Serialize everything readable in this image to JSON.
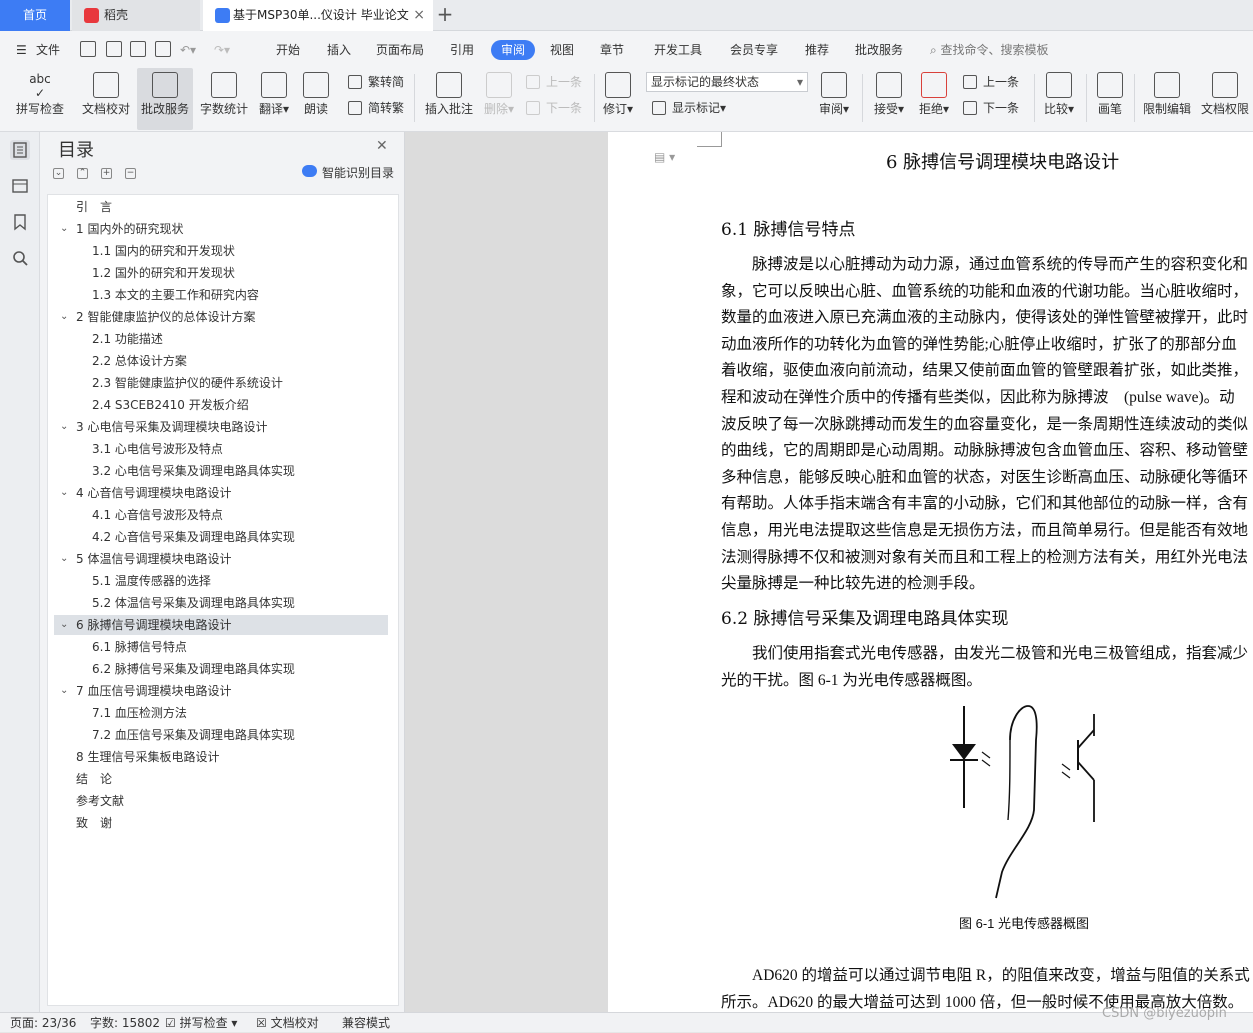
{
  "tabs": {
    "home": "首页",
    "daoke": "稻壳",
    "doc": "基于MSP30单...仪设计 毕业论文",
    "close": "×",
    "add": "+"
  },
  "menu": {
    "file": "文件",
    "items": [
      "开始",
      "插入",
      "页面布局",
      "引用",
      "审阅",
      "视图",
      "章节",
      "开发工具",
      "会员专享",
      "推荐",
      "批改服务"
    ],
    "active": "审阅",
    "search": "查找命令、搜索模板"
  },
  "ribbon": {
    "spellcheck": "拼写检查",
    "doccheck": "文档校对",
    "correct": "批改服务",
    "wordcount": "字数统计",
    "translate": "翻译",
    "read": "朗读",
    "trad": "繁转简",
    "simp": "简转繁",
    "insert_comment": "插入批注",
    "delete": "删除",
    "prev_comment": "上一条",
    "next_comment": "下一条",
    "revise": "修订",
    "markup_select": "显示标记的最终状态",
    "show_markup": "显示标记",
    "review": "审阅",
    "accept": "接受",
    "reject": "拒绝",
    "prev": "上一条",
    "next": "下一条",
    "compare": "比较",
    "pen": "画笔",
    "restrict": "限制编辑",
    "permission": "文档权限"
  },
  "toc": {
    "title": "目录",
    "smart": "智能识别目录",
    "items": [
      {
        "label": "引　言",
        "level": 0,
        "arrow": ""
      },
      {
        "label": "1  国内外的研究现状",
        "level": 0,
        "arrow": "v"
      },
      {
        "label": "1.1 国内的研究和开发现状",
        "level": 1,
        "arrow": ""
      },
      {
        "label": "1.2 国外的研究和开发现状",
        "level": 1,
        "arrow": ""
      },
      {
        "label": "1.3 本文的主要工作和研究内容",
        "level": 1,
        "arrow": ""
      },
      {
        "label": "2 智能健康监护仪的总体设计方案",
        "level": 0,
        "arrow": "v"
      },
      {
        "label": "2.1 功能描述",
        "level": 1,
        "arrow": ""
      },
      {
        "label": "2.2 总体设计方案",
        "level": 1,
        "arrow": ""
      },
      {
        "label": "2.3 智能健康监护仪的硬件系统设计",
        "level": 1,
        "arrow": ""
      },
      {
        "label": "2.4 S3CEB2410 开发板介绍",
        "level": 1,
        "arrow": ""
      },
      {
        "label": "3 心电信号采集及调理模块电路设计",
        "level": 0,
        "arrow": "v"
      },
      {
        "label": "3.1 心电信号波形及特点",
        "level": 1,
        "arrow": ""
      },
      {
        "label": "3.2 心电信号采集及调理电路具体实现",
        "level": 1,
        "arrow": ""
      },
      {
        "label": "4 心音信号调理模块电路设计",
        "level": 0,
        "arrow": "v"
      },
      {
        "label": "4.1 心音信号波形及特点",
        "level": 1,
        "arrow": ""
      },
      {
        "label": "4.2 心音信号采集及调理电路具体实现",
        "level": 1,
        "arrow": ""
      },
      {
        "label": "5 体温信号调理模块电路设计",
        "level": 0,
        "arrow": "v"
      },
      {
        "label": "5.1 温度传感器的选择",
        "level": 1,
        "arrow": ""
      },
      {
        "label": "5.2 体温信号采集及调理电路具体实现",
        "level": 1,
        "arrow": ""
      },
      {
        "label": "6 脉搏信号调理模块电路设计",
        "level": 0,
        "arrow": "v",
        "selected": true
      },
      {
        "label": "6.1 脉搏信号特点",
        "level": 1,
        "arrow": ""
      },
      {
        "label": "6.2 脉搏信号采集及调理电路具体实现",
        "level": 1,
        "arrow": ""
      },
      {
        "label": "7 血压信号调理模块电路设计",
        "level": 0,
        "arrow": "v"
      },
      {
        "label": "7.1 血压检测方法",
        "level": 1,
        "arrow": ""
      },
      {
        "label": "7.2 血压信号采集及调理电路具体实现",
        "level": 1,
        "arrow": ""
      },
      {
        "label": "8 生理信号采集板电路设计",
        "level": 0,
        "arrow": ""
      },
      {
        "label": "结　论",
        "level": 0,
        "arrow": ""
      },
      {
        "label": "参考文献",
        "level": 0,
        "arrow": ""
      },
      {
        "label": "致　谢",
        "level": 0,
        "arrow": ""
      }
    ]
  },
  "doc": {
    "h1": "6 脉搏信号调理模块电路设计",
    "h2a": "6.1 脉搏信号特点",
    "para1": [
      "　　脉搏波是以心脏搏动为动力源，通过血管系统的传导而产生的容积变化和",
      "象，它可以反映出心脏、血管系统的功能和血液的代谢功能。当心脏收缩时，",
      "数量的血液进入原已充满血液的主动脉内，使得该处的弹性管壁被撑开，此时",
      "动血液所作的功转化为血管的弹性势能;心脏停止收缩时，扩张了的那部分血",
      "着收缩，驱使血液向前流动，结果又使前面血管的管壁跟着扩张，如此类推，",
      "程和波动在弹性介质中的传播有些类似，因此称为脉搏波　(pulse wave)。动",
      "波反映了每一次脉跳搏动而发生的血容量变化，是一条周期性连续波动的类似",
      "的曲线，它的周期即是心动周期。动脉脉搏波包含血管血压、容积、移动管壁",
      "多种信息，能够反映心脏和血管的状态，对医生诊断高血压、动脉硬化等循环",
      "有帮助。人体手指末端含有丰富的小动脉，它们和其他部位的动脉一样，含有",
      "信息，用光电法提取这些信息是无损伤方法，而且简单易行。但是能否有效地",
      "法测得脉搏不仅和被测对象有关而且和工程上的检测方法有关，用红外光电法",
      "尖量脉搏是一种比较先进的检测手段。"
    ],
    "h2b": "6.2 脉搏信号采集及调理电路具体实现",
    "para2": [
      "　　我们使用指套式光电传感器，由发光二极管和光电三极管组成，指套减少",
      "光的干扰。图 6-1 为光电传感器概图。"
    ],
    "fig_caption": "图 6-1 光电传感器概图",
    "para3": [
      "　　AD620 的增益可以通过调节电阻 R，的阻值来改变，增益与阻值的关系式",
      "所示。AD620 的最大增益可达到 1000 倍，但一般时候不使用最高放大倍数。"
    ]
  },
  "status": {
    "page": "页面: 23/36",
    "words": "字数: 15802",
    "spell": "拼写检查",
    "doccheck": "文档校对",
    "compat": "兼容模式"
  },
  "watermark": "CSDN @biyezuopin",
  "colors": {
    "accent": "#3d7cf4",
    "toc_selected": "#dde1e6",
    "page": "#ffffff"
  }
}
